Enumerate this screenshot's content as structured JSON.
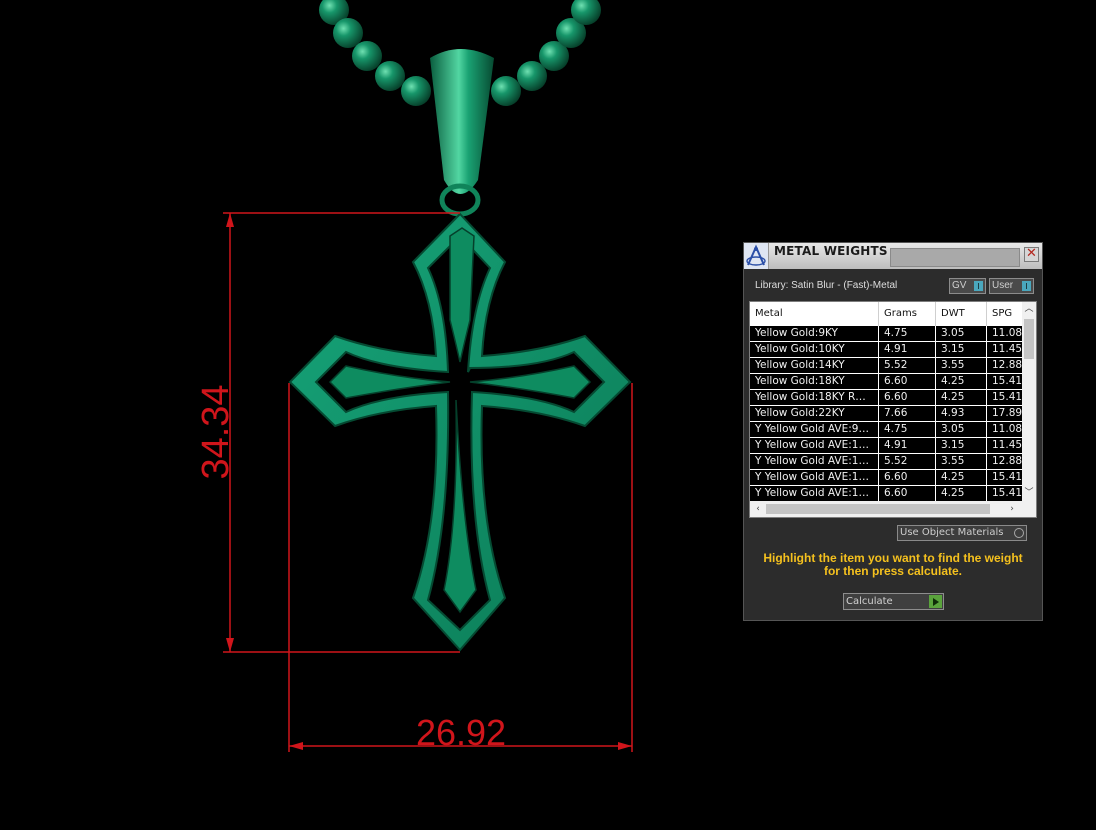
{
  "viewport": {
    "dimension_height": "34.34",
    "dimension_width": "26.92",
    "model_color": "#118a5c",
    "dimension_color": "#d0151b"
  },
  "panel": {
    "title": "METAL WEIGHTS",
    "icon": "app-logo-icon",
    "library_label": "Library: Satin Blur - (Fast)-Metal",
    "gv_toggle": "GV",
    "user_toggle": "User",
    "columns": [
      "Metal",
      "Grams",
      "DWT",
      "SPG"
    ],
    "rows": [
      [
        "Yellow Gold:9KY",
        "4.75",
        "3.05",
        "11.08"
      ],
      [
        "Yellow Gold:10KY",
        "4.91",
        "3.15",
        "11.45"
      ],
      [
        "Yellow Gold:14KY",
        "5.52",
        "3.55",
        "12.88"
      ],
      [
        "Yellow Gold:18KY",
        "6.60",
        "4.25",
        "15.41"
      ],
      [
        "Yellow Gold:18KY R…",
        "6.60",
        "4.25",
        "15.41"
      ],
      [
        "Yellow Gold:22KY",
        "7.66",
        "4.93",
        "17.89"
      ],
      [
        "Y Yellow Gold AVE:9…",
        "4.75",
        "3.05",
        "11.08"
      ],
      [
        "Y Yellow Gold AVE:1…",
        "4.91",
        "3.15",
        "11.45"
      ],
      [
        "Y Yellow Gold AVE:1…",
        "5.52",
        "3.55",
        "12.88"
      ],
      [
        "Y Yellow Gold AVE:1…",
        "6.60",
        "4.25",
        "15.41"
      ],
      [
        "Y Yellow Gold AVE:1…",
        "6.60",
        "4.25",
        "15.41"
      ]
    ],
    "use_object_materials": "Use Object Materials",
    "hint": "Highlight the item you want to find the weight for then press calculate.",
    "calculate_button": "Calculate",
    "accent_color": "#f5c11e"
  }
}
